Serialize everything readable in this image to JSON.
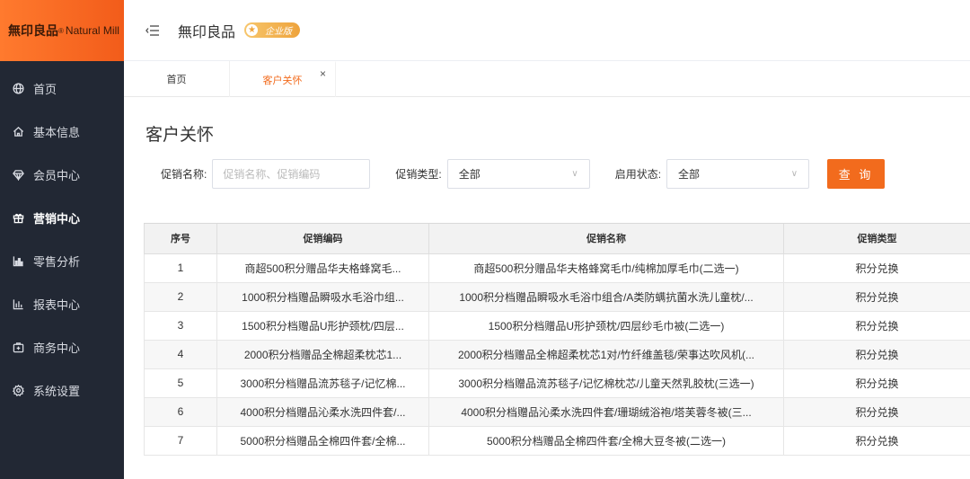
{
  "app": {
    "logo_cn": "無印良品",
    "logo_reg": "®",
    "logo_en": "Natural Mill",
    "brand_title": "無印良品",
    "edition": "企业版"
  },
  "sidebar": {
    "items": [
      {
        "label": "首页",
        "icon": "globe-icon"
      },
      {
        "label": "基本信息",
        "icon": "home-icon"
      },
      {
        "label": "会员中心",
        "icon": "diamond-icon"
      },
      {
        "label": "营销中心",
        "icon": "gift-icon",
        "active": true
      },
      {
        "label": "零售分析",
        "icon": "bar-chart-icon"
      },
      {
        "label": "报表中心",
        "icon": "report-icon"
      },
      {
        "label": "商务中心",
        "icon": "briefcase-icon"
      },
      {
        "label": "系统设置",
        "icon": "gear-icon"
      }
    ]
  },
  "tabs": [
    {
      "label": "首页"
    },
    {
      "label": "客户关怀",
      "active": true,
      "close": "×"
    }
  ],
  "page": {
    "title": "客户关怀"
  },
  "filters": {
    "name_label": "促销名称:",
    "name_placeholder": "促销名称、促销编码",
    "type_label": "促销类型:",
    "type_value": "全部",
    "status_label": "启用状态:",
    "status_value": "全部",
    "query_label": "查 询"
  },
  "table": {
    "columns": [
      "序号",
      "促销编码",
      "促销名称",
      "促销类型"
    ],
    "rows": [
      {
        "no": "1",
        "code": "商超500积分赠品华夫格蜂窝毛...",
        "name": "商超500积分赠品华夫格蜂窝毛巾/纯棉加厚毛巾(二选一)",
        "type": "积分兑换"
      },
      {
        "no": "2",
        "code": "1000积分档赠品瞬吸水毛浴巾组...",
        "name": "1000积分档赠品瞬吸水毛浴巾组合/A类防螨抗菌水洗儿童枕/...",
        "type": "积分兑换"
      },
      {
        "no": "3",
        "code": "1500积分档赠品U形护颈枕/四层...",
        "name": "1500积分档赠品U形护颈枕/四层纱毛巾被(二选一)",
        "type": "积分兑换"
      },
      {
        "no": "4",
        "code": "2000积分档赠品全棉超柔枕芯1...",
        "name": "2000积分档赠品全棉超柔枕芯1对/竹纤维盖毯/荣事达吹风机(...",
        "type": "积分兑换"
      },
      {
        "no": "5",
        "code": "3000积分档赠品流苏毯子/记忆棉...",
        "name": "3000积分档赠品流苏毯子/记忆棉枕芯/儿童天然乳胶枕(三选一)",
        "type": "积分兑换"
      },
      {
        "no": "6",
        "code": "4000积分档赠品沁柔水洗四件套/...",
        "name": "4000积分档赠品沁柔水洗四件套/珊瑚绒浴袍/塔芙蓉冬被(三...",
        "type": "积分兑换"
      },
      {
        "no": "7",
        "code": "5000积分档赠品全棉四件套/全棉...",
        "name": "5000积分档赠品全棉四件套/全棉大豆冬被(二选一)",
        "type": "积分兑换"
      }
    ]
  },
  "colors": {
    "accent": "#f26b1d",
    "sidebar_bg": "#222834"
  }
}
